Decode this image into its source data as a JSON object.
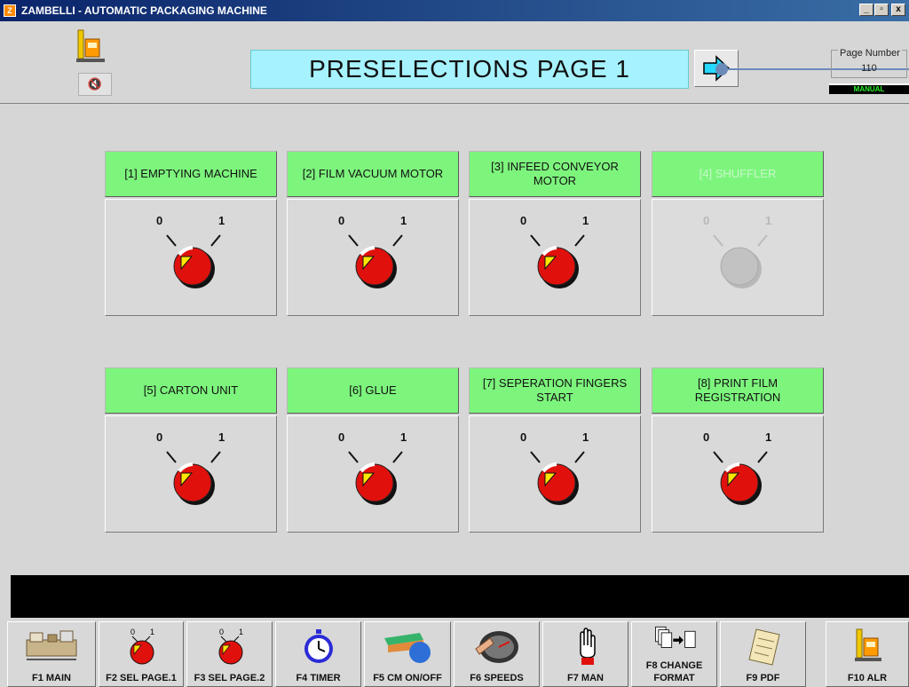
{
  "window": {
    "title": "ZAMBELLI - AUTOMATIC PACKAGING MACHINE",
    "app_icon": "Z",
    "buttons": {
      "minimize": "_",
      "restore": "▫",
      "close": "x"
    }
  },
  "header": {
    "page_title": "PRESELECTIONS PAGE 1",
    "page_number_label": "Page Number",
    "page_number": "110",
    "mode": "MANUAL",
    "mute_icon": "🔇"
  },
  "panels": [
    {
      "label": "[1] EMPTYING MACHINE",
      "zero": "0",
      "one": "1",
      "state": "off",
      "enabled": true
    },
    {
      "label": "[2] FILM VACUUM MOTOR",
      "zero": "0",
      "one": "1",
      "state": "off",
      "enabled": true
    },
    {
      "label": "[3] INFEED CONVEYOR MOTOR",
      "zero": "0",
      "one": "1",
      "state": "off",
      "enabled": true
    },
    {
      "label": "[4] SHUFFLER",
      "zero": "0",
      "one": "1",
      "state": "off",
      "enabled": false
    },
    {
      "label": "[5] CARTON UNIT",
      "zero": "0",
      "one": "1",
      "state": "off",
      "enabled": true
    },
    {
      "label": "[6] GLUE",
      "zero": "0",
      "one": "1",
      "state": "off",
      "enabled": true
    },
    {
      "label": "[7] SEPERATION FINGERS START",
      "zero": "0",
      "one": "1",
      "state": "off",
      "enabled": true
    },
    {
      "label": "[8] PRINT FILM REGISTRATION",
      "zero": "0",
      "one": "1",
      "state": "off",
      "enabled": true
    }
  ],
  "function_keys": [
    {
      "label": "F1 MAIN",
      "icon": "machine-icon"
    },
    {
      "label": "F2 SEL PAGE.1",
      "icon": "selector-switch-icon"
    },
    {
      "label": "F3 SEL PAGE.2",
      "icon": "selector-switch-icon"
    },
    {
      "label": "F4 TIMER",
      "icon": "stopwatch-icon"
    },
    {
      "label": "F5 CM ON/OFF",
      "icon": "conveyor-icon"
    },
    {
      "label": "F6 SPEEDS",
      "icon": "speedometer-icon"
    },
    {
      "label": "F7 MAN",
      "icon": "hand-icon"
    },
    {
      "label": "F8 CHANGE FORMAT",
      "icon": "change-format-icon"
    },
    {
      "label": "F9 PDF",
      "icon": "document-icon"
    },
    {
      "label": "F10 ALR",
      "icon": "alarm-icon"
    }
  ],
  "colors": {
    "panel_header": "#7df57d",
    "title_background": "#a6f2ff",
    "knob": "#e0110d",
    "indicator": "#ffe600",
    "message_bar": "#000000"
  }
}
